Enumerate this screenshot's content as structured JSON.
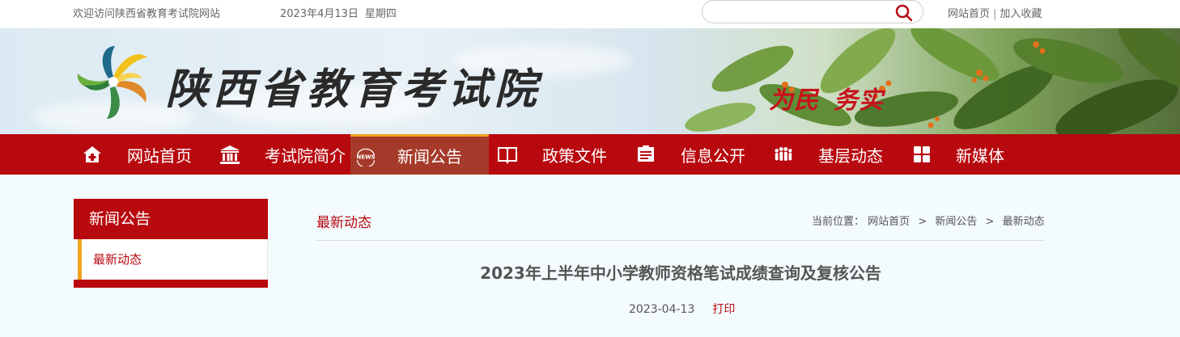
{
  "topbar": {
    "welcome": "欢迎访问陕西省教育考试院网站",
    "date": "2023年4月13日",
    "weekday": "星期四",
    "search_placeholder": "",
    "links": [
      "网站首页",
      "加入收藏"
    ],
    "separator": "|"
  },
  "banner": {
    "site_name": "陕西省教育考试院",
    "slogan_part1": "为民",
    "slogan_part2": "务实"
  },
  "nav": {
    "items": [
      {
        "label": "网站首页",
        "icon": "home-icon"
      },
      {
        "label": "考试院简介",
        "icon": "building-icon"
      },
      {
        "label": "新闻公告",
        "icon": "news-icon",
        "icon_text": "NEWS",
        "active": true
      },
      {
        "label": "政策文件",
        "icon": "book-icon"
      },
      {
        "label": "信息公开",
        "icon": "document-icon"
      },
      {
        "label": "基层动态",
        "icon": "people-icon"
      },
      {
        "label": "新媒体",
        "icon": "grid-icon"
      }
    ]
  },
  "sidebar": {
    "title": "新闻公告",
    "items": [
      {
        "label": "最新动态",
        "active": true
      }
    ]
  },
  "main": {
    "section_title": "最新动态",
    "breadcrumb": {
      "prefix": "当前位置：",
      "items": [
        "网站首页",
        "新闻公告",
        "最新动态"
      ],
      "separator": ">"
    },
    "article": {
      "title": "2023年上半年中小学教师资格笔试成绩查询及复核公告",
      "date": "2023-04-13",
      "print_label": "打印"
    }
  },
  "colors": {
    "brand_red": "#b8090f",
    "accent_orange": "#f0a31e",
    "active_nav": "#a63a2a",
    "content_bg": "#f3fbfd"
  }
}
